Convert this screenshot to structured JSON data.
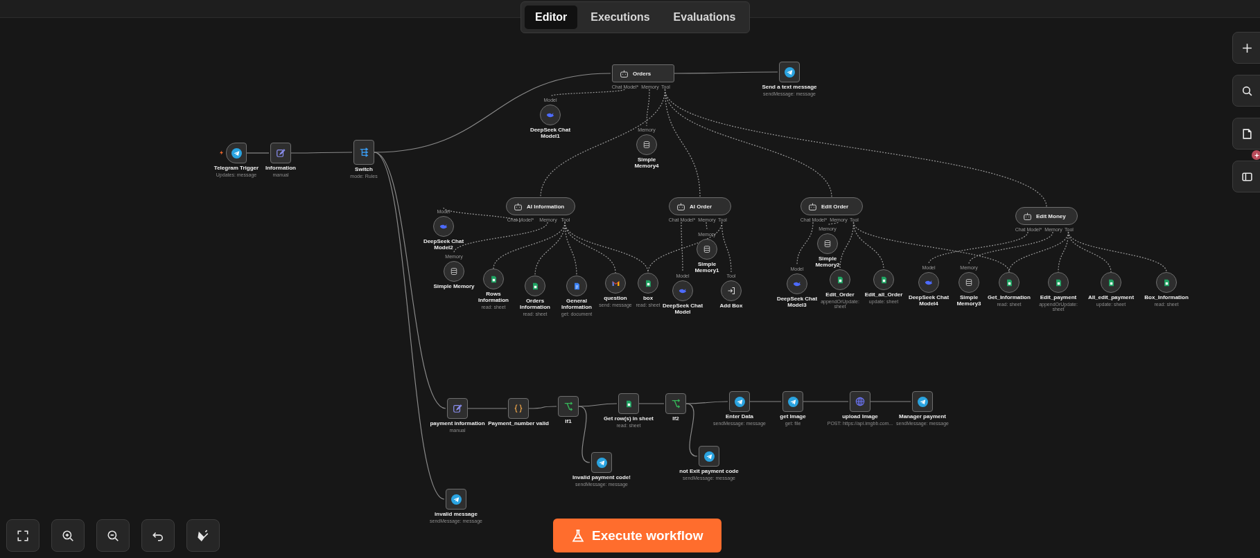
{
  "tabs": [
    {
      "label": "Editor",
      "selected": true
    },
    {
      "label": "Executions",
      "selected": false
    },
    {
      "label": "Evaluations",
      "selected": false
    }
  ],
  "nodes": [
    {
      "kind": "trigger",
      "label": "Telegram Trigger",
      "subtitle": "Updates: message"
    },
    {
      "kind": "action",
      "label": "Information",
      "subtitle": "manual"
    },
    {
      "kind": "action",
      "label": "Switch",
      "subtitle": "mode: Rules"
    },
    {
      "kind": "agent",
      "label": "Orders",
      "ports": [
        "Chat Model*",
        "Memory",
        "Tool"
      ]
    },
    {
      "kind": "action",
      "label": "Send a text message",
      "subtitle": "sendMessage: message"
    },
    {
      "kind": "sub",
      "label": "DeepSeek Chat Model1",
      "port_label": "Model"
    },
    {
      "kind": "sub",
      "label": "Simple Memory4",
      "port_label": "Memory"
    },
    {
      "kind": "agent",
      "label": "AI Information",
      "ports": [
        "Chat Model*",
        "Memory",
        "Tool"
      ]
    },
    {
      "kind": "agent",
      "label": "AI Order",
      "ports": [
        "Chat Model*",
        "Memory",
        "Tool"
      ]
    },
    {
      "kind": "agent",
      "label": "Edit Order",
      "ports": [
        "Chat Model*",
        "Memory",
        "Tool"
      ]
    },
    {
      "kind": "agent",
      "label": "Edit Money",
      "ports": [
        "Chat Model*",
        "Memory",
        "Tool"
      ]
    },
    {
      "kind": "sub",
      "label": "DeepSeek Chat Model2",
      "port_label": "Model"
    },
    {
      "kind": "sub",
      "label": "Simple Memory",
      "port_label": "Memory"
    },
    {
      "kind": "sub",
      "label": "Rows Information",
      "subtitle": "read: sheet"
    },
    {
      "kind": "sub",
      "label": "Orders Information",
      "subtitle": "read: sheet"
    },
    {
      "kind": "sub",
      "label": "General Information",
      "subtitle": "get: document"
    },
    {
      "kind": "sub",
      "label": "question",
      "subtitle": "send: message"
    },
    {
      "kind": "sub",
      "label": "box",
      "subtitle": "read: sheet"
    },
    {
      "kind": "sub",
      "label": "DeepSeek Chat Model",
      "port_label": "Model"
    },
    {
      "kind": "sub",
      "label": "Simple Memory1",
      "port_label": "Memory"
    },
    {
      "kind": "sub",
      "label": "Add Box",
      "port_label": "Tool"
    },
    {
      "kind": "sub",
      "label": "Simple Memory2",
      "port_label": "Memory"
    },
    {
      "kind": "sub",
      "label": "DeepSeek Chat Model3",
      "port_label": "Model"
    },
    {
      "kind": "sub",
      "label": "Edit_Order",
      "subtitle": "appendOrUpdate: sheet"
    },
    {
      "kind": "sub",
      "label": "Edit_all_Order",
      "subtitle": "update: sheet"
    },
    {
      "kind": "sub",
      "label": "DeepSeek Chat Model4",
      "port_label": "Model"
    },
    {
      "kind": "sub",
      "label": "Simple Memory3",
      "port_label": "Memory"
    },
    {
      "kind": "sub",
      "label": "Get_Information",
      "subtitle": "read: sheet"
    },
    {
      "kind": "sub",
      "label": "Edit_payment",
      "subtitle": "appendOrUpdate: sheet"
    },
    {
      "kind": "sub",
      "label": "All_edit_payment",
      "subtitle": "update: sheet"
    },
    {
      "kind": "sub",
      "label": "Box_Information",
      "subtitle": "read: sheet"
    },
    {
      "kind": "action",
      "label": "payment information",
      "subtitle": "manual"
    },
    {
      "kind": "action",
      "label": "Payment_number valid"
    },
    {
      "kind": "action",
      "label": "If1"
    },
    {
      "kind": "action",
      "label": "Get row(s) in sheet",
      "subtitle": "read: sheet"
    },
    {
      "kind": "action",
      "label": "If2"
    },
    {
      "kind": "action",
      "label": "Enter Data",
      "subtitle": "sendMessage: message"
    },
    {
      "kind": "action",
      "label": "get Image",
      "subtitle": "get: file"
    },
    {
      "kind": "action",
      "label": "upload Image",
      "subtitle": "POST: https://api.imgbb.com..."
    },
    {
      "kind": "action",
      "label": "Manager payment",
      "subtitle": "sendMessage: message"
    },
    {
      "kind": "action",
      "label": "Invalid payment code!",
      "subtitle": "sendMessage: message"
    },
    {
      "kind": "action",
      "label": "not Exit payment code",
      "subtitle": "sendMessage: message"
    },
    {
      "kind": "action",
      "label": "invalid message",
      "subtitle": "sendMessage: message"
    }
  ],
  "execute_button": {
    "label": "Execute workflow"
  }
}
